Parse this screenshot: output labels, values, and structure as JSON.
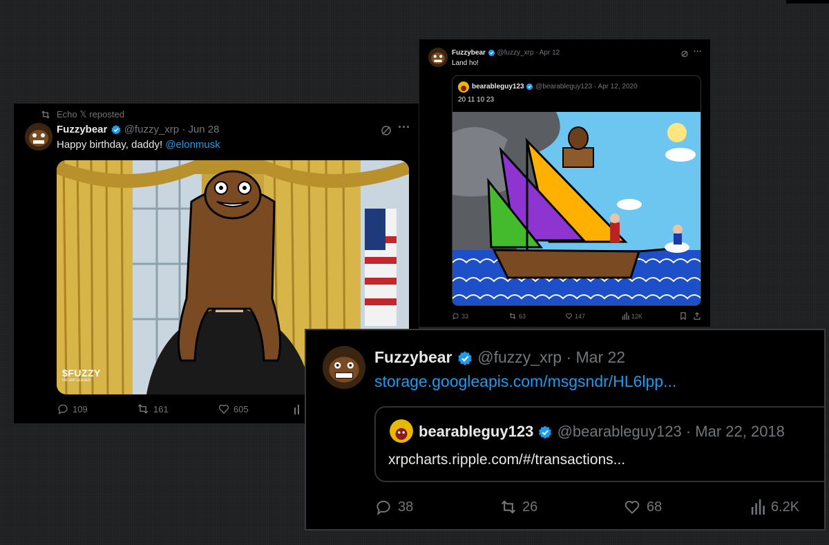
{
  "tweet1": {
    "repost_label": "Echo 𝕏 reposted",
    "name": "Fuzzybear",
    "handle": "@fuzzy_xrp",
    "date": "· Jun 28",
    "text": "Happy birthday, daddy! ",
    "mention": "@elonmusk",
    "image_brand": "$FUZZY",
    "image_brand_sub": "ON XRP LEDGER",
    "stats": {
      "replies": "109",
      "reposts": "161",
      "likes": "605"
    }
  },
  "tweet2": {
    "name": "Fuzzybear",
    "handle": "@fuzzy_xrp",
    "date": "· Apr 12",
    "text": "Land ho!",
    "quote": {
      "name": "bearableguy123",
      "handle": "@bearableguy123",
      "date": "· Apr 12, 2020",
      "text": "20 11 10 23"
    },
    "stats": {
      "replies": "33",
      "reposts": "63",
      "likes": "147",
      "views": "12K"
    }
  },
  "tweet3": {
    "name": "Fuzzybear",
    "handle": "@fuzzy_xrp",
    "date": "· Mar 22",
    "link": "storage.googleapis.com/msgsndr/HL6lpp...",
    "quote": {
      "name": "bearableguy123",
      "handle": "@bearableguy123",
      "date": "· Mar 22, 2018",
      "text": "xrpcharts.ripple.com/#/transactions..."
    },
    "stats": {
      "replies": "38",
      "reposts": "26",
      "likes": "68",
      "views": "6.2K"
    }
  },
  "colors": {
    "link": "#1d9bf0",
    "muted": "#71767b",
    "text": "#e7e9ea",
    "card_bg": "#000000"
  }
}
